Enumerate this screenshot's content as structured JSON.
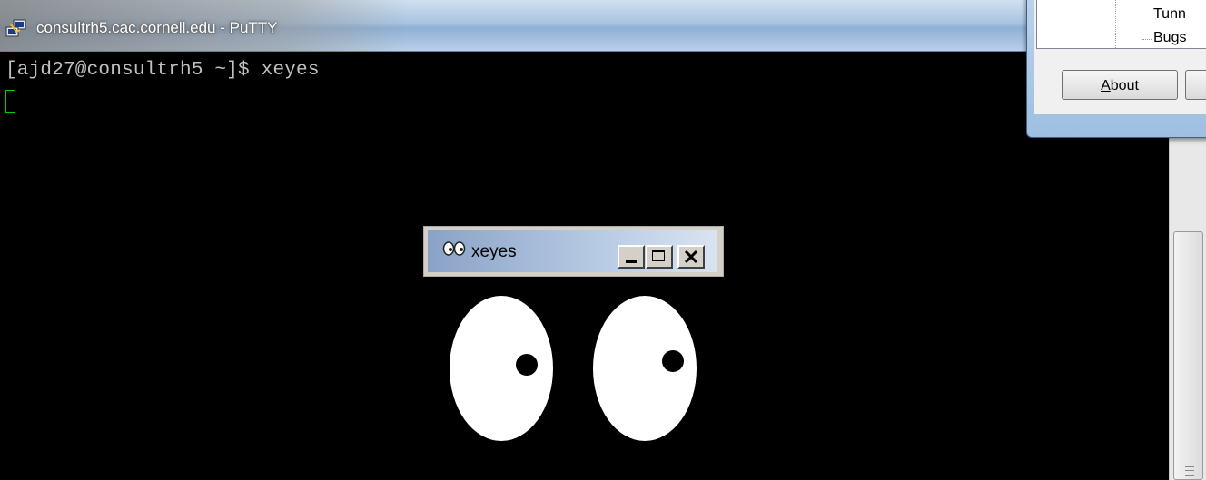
{
  "putty": {
    "title": "consultrh5.cac.cornell.edu - PuTTY",
    "prompt_line": "[ajd27@consultrh5 ~]$ xeyes"
  },
  "config_dialog": {
    "tree_items": [
      "Tunn",
      "Bugs"
    ],
    "about_prefix": "A",
    "about_rest": "bout"
  },
  "xeyes": {
    "title": "xeyes"
  },
  "icons": {
    "putty": "putty-icon",
    "xeyes": "xeyes-icon",
    "minimize": "minimize-icon",
    "maximize": "maximize-icon",
    "close": "close-icon"
  },
  "colors": {
    "terminal_bg": "#000000",
    "terminal_text": "#c0c0c0",
    "cursor": "#00d000",
    "eye_white": "#ffffff"
  }
}
